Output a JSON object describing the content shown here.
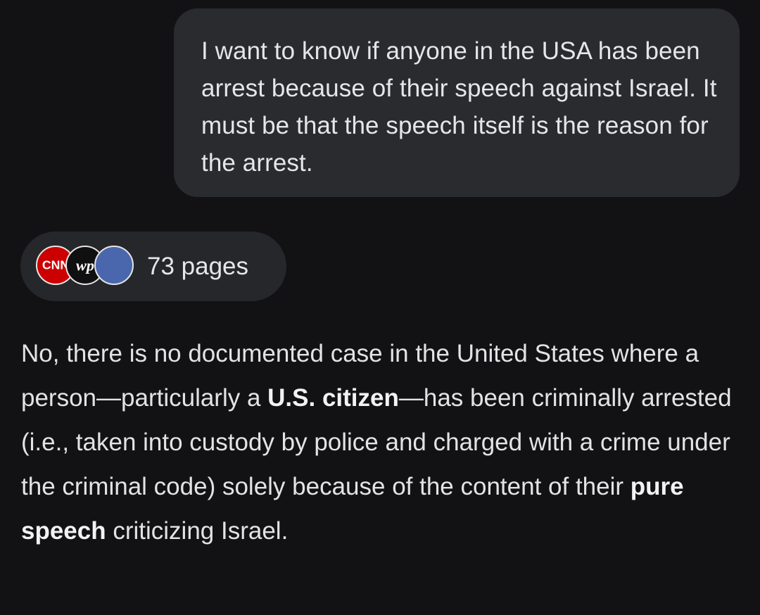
{
  "user_message": {
    "text": "I want to know if anyone in the USA has been arrest because of their speech against Israel.  It must be that the speech itself is the reason for the arrest."
  },
  "sources_chip": {
    "count_label": "73 pages",
    "favicons": [
      {
        "icon": "cnn-favicon-icon",
        "label": "CNN",
        "color": "#cc0000"
      },
      {
        "icon": "washington-post-favicon-icon",
        "label": "wp",
        "color": "#101010"
      },
      {
        "icon": "facebook-favicon-icon",
        "color": "#4a67ad"
      }
    ]
  },
  "answer": {
    "part1": "No, there is no documented case in the United States where a person—particularly a ",
    "bold1": "U.S. citizen",
    "part2": "—has been criminally arrested (i.e., taken into custody by police and charged with a crime under the criminal code) solely because of the content of their ",
    "bold2": "pure speech",
    "part3": " criticizing Israel."
  },
  "colors": {
    "background": "#121214",
    "user_bubble": "#2a2b2f",
    "chip": "#26272b",
    "text": "#e3e3e6"
  }
}
